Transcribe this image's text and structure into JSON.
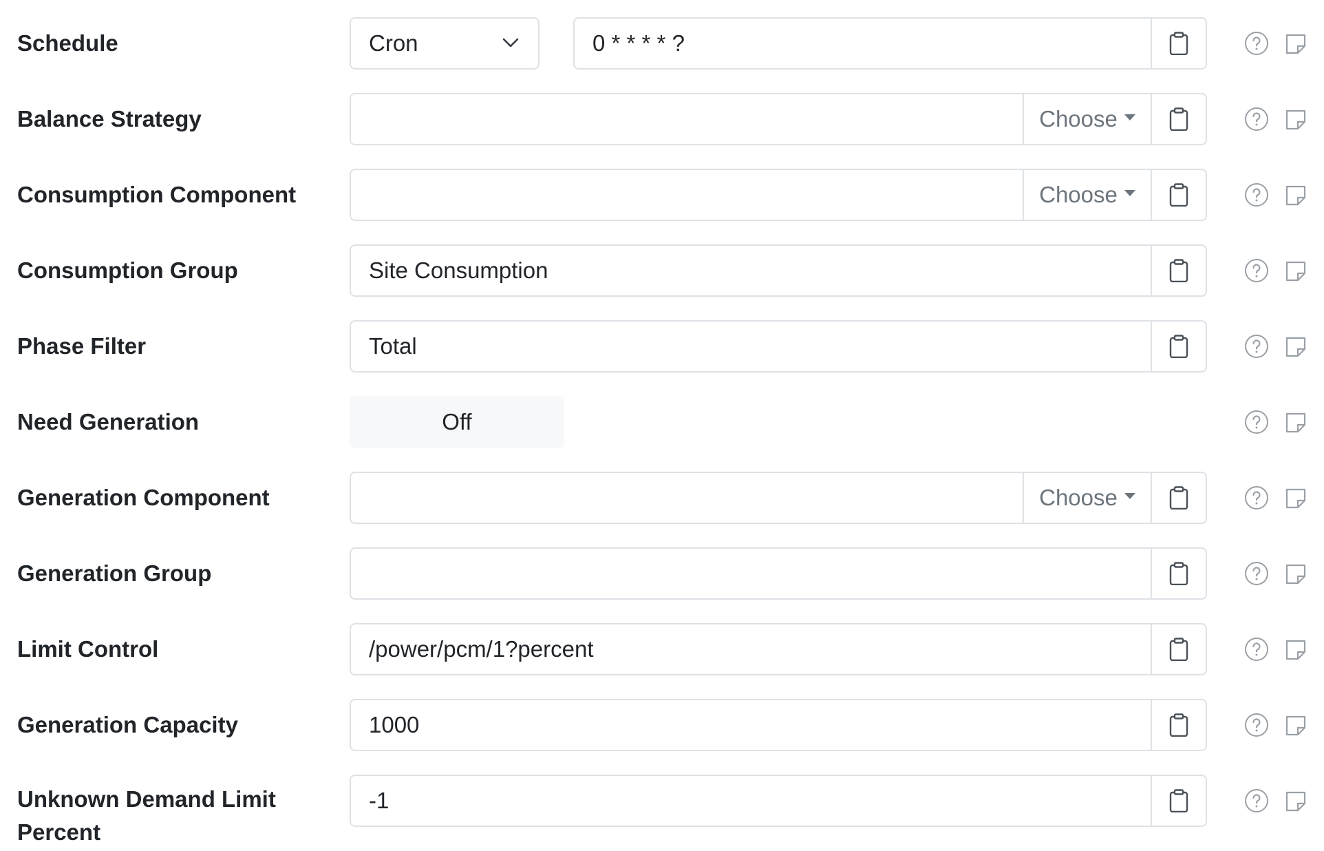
{
  "schedule": {
    "label": "Schedule",
    "type_value": "Cron",
    "cron_value": "0 * * * * ?"
  },
  "balance_strategy": {
    "label": "Balance Strategy",
    "value": "",
    "choose_label": "Choose"
  },
  "consumption_component": {
    "label": "Consumption Component",
    "value": "",
    "choose_label": "Choose"
  },
  "consumption_group": {
    "label": "Consumption Group",
    "value": "Site Consumption"
  },
  "phase_filter": {
    "label": "Phase Filter",
    "value": "Total"
  },
  "need_generation": {
    "label": "Need Generation",
    "toggle_value": "Off"
  },
  "generation_component": {
    "label": "Generation Component",
    "value": "",
    "choose_label": "Choose"
  },
  "generation_group": {
    "label": "Generation Group",
    "value": ""
  },
  "limit_control": {
    "label": "Limit Control",
    "value": "/power/pcm/1?percent"
  },
  "generation_capacity": {
    "label": "Generation Capacity",
    "value": "1000"
  },
  "unknown_demand_limit_percent": {
    "label": "Unknown Demand Limit Percent",
    "value": "-1"
  },
  "icons": {
    "copy": "clipboard-icon",
    "help": "help-circle-icon",
    "note": "sticky-note-icon",
    "dropdown": "chevron-down-icon",
    "choose": "caret-down-icon"
  },
  "colors": {
    "border": "#dee2e6",
    "text": "#212529",
    "muted": "#6c757d",
    "toggle_bg": "#f7f8f9"
  }
}
